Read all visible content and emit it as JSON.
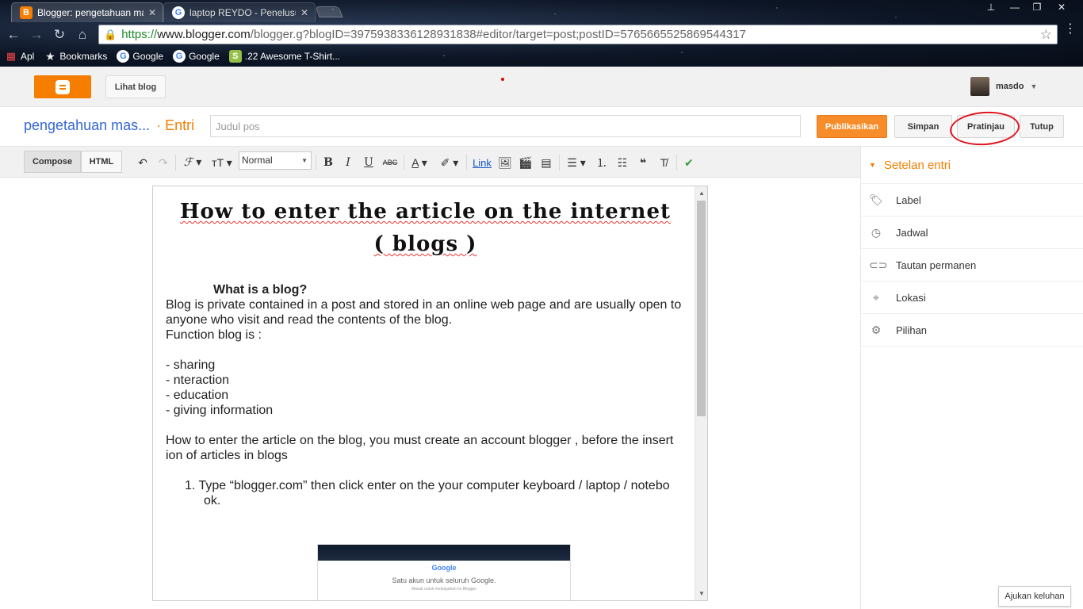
{
  "browser": {
    "tabs": [
      {
        "title": "Blogger: pengetahuan ma",
        "icon": "blogger-icon"
      },
      {
        "title": "laptop REYDO - Penelusur",
        "icon": "google-icon"
      }
    ],
    "url": {
      "scheme": "https://",
      "host": "www.blogger.com",
      "path": "/blogger.g?blogID=3975938336128931838#editor/target=post;postID=5765665525869544317"
    },
    "bookmarks": [
      {
        "label": "Apl",
        "icon": "apps-grid-icon"
      },
      {
        "label": "Bookmarks",
        "icon": "star-icon"
      },
      {
        "label": "Google",
        "icon": "google-icon"
      },
      {
        "label": "Google",
        "icon": "google-icon"
      },
      {
        "label": ".22 Awesome T-Shirt...",
        "icon": "shopify-icon"
      }
    ]
  },
  "header": {
    "view_blog": "Lihat blog",
    "user": "masdo"
  },
  "title_row": {
    "blog_name": "pengetahuan mas...",
    "section": "· Entri",
    "title_placeholder": "Judul pos",
    "publish": "Publikasikan",
    "save": "Simpan",
    "preview": "Pratinjau",
    "close": "Tutup"
  },
  "toolbar": {
    "compose": "Compose",
    "html": "HTML",
    "format": "Normal",
    "bold": "B",
    "italic": "I",
    "underline": "U",
    "strike": "ABC",
    "link": "Link"
  },
  "post": {
    "title_line1": "How to enter the article on the internet",
    "title_line2": "( blogs )",
    "heading": "What is a blog?",
    "para1_line1": "Blog is private contained in a post and stored in an online web page and are usually open to",
    "para1_line2": " anyone who visit and read the contents of the blog.",
    "function_line": "Function blog is :",
    "functions": [
      "- sharing",
      "- nteraction",
      "- education",
      "- giving information"
    ],
    "para2_line1": "How to enter the article on the blog, you must create an account blogger , before the insert",
    "para2_line2": "ion of articles in blogs",
    "step1_line1": "1.  Type “blogger.com” then click enter on the your computer keyboard / laptop / notebo",
    "step1_line2": "ok.",
    "embed": {
      "logo": "Google",
      "line1": "Satu akun untuk seluruh Google.",
      "line2": "Masuk untuk melanjutkan ke Blogger"
    }
  },
  "sidebar": {
    "title": "Setelan entri",
    "items": [
      {
        "label": "Label",
        "icon": "tag-icon"
      },
      {
        "label": "Jadwal",
        "icon": "clock-icon"
      },
      {
        "label": "Tautan permanen",
        "icon": "link-icon"
      },
      {
        "label": "Lokasi",
        "icon": "location-pin-icon"
      },
      {
        "label": "Pilihan",
        "icon": "gear-icon"
      }
    ]
  },
  "feedback": "Ajukan keluhan",
  "colors": {
    "brand_orange": "#f57d00",
    "link_blue": "#3367d6",
    "annotation_red": "#e0141e"
  }
}
